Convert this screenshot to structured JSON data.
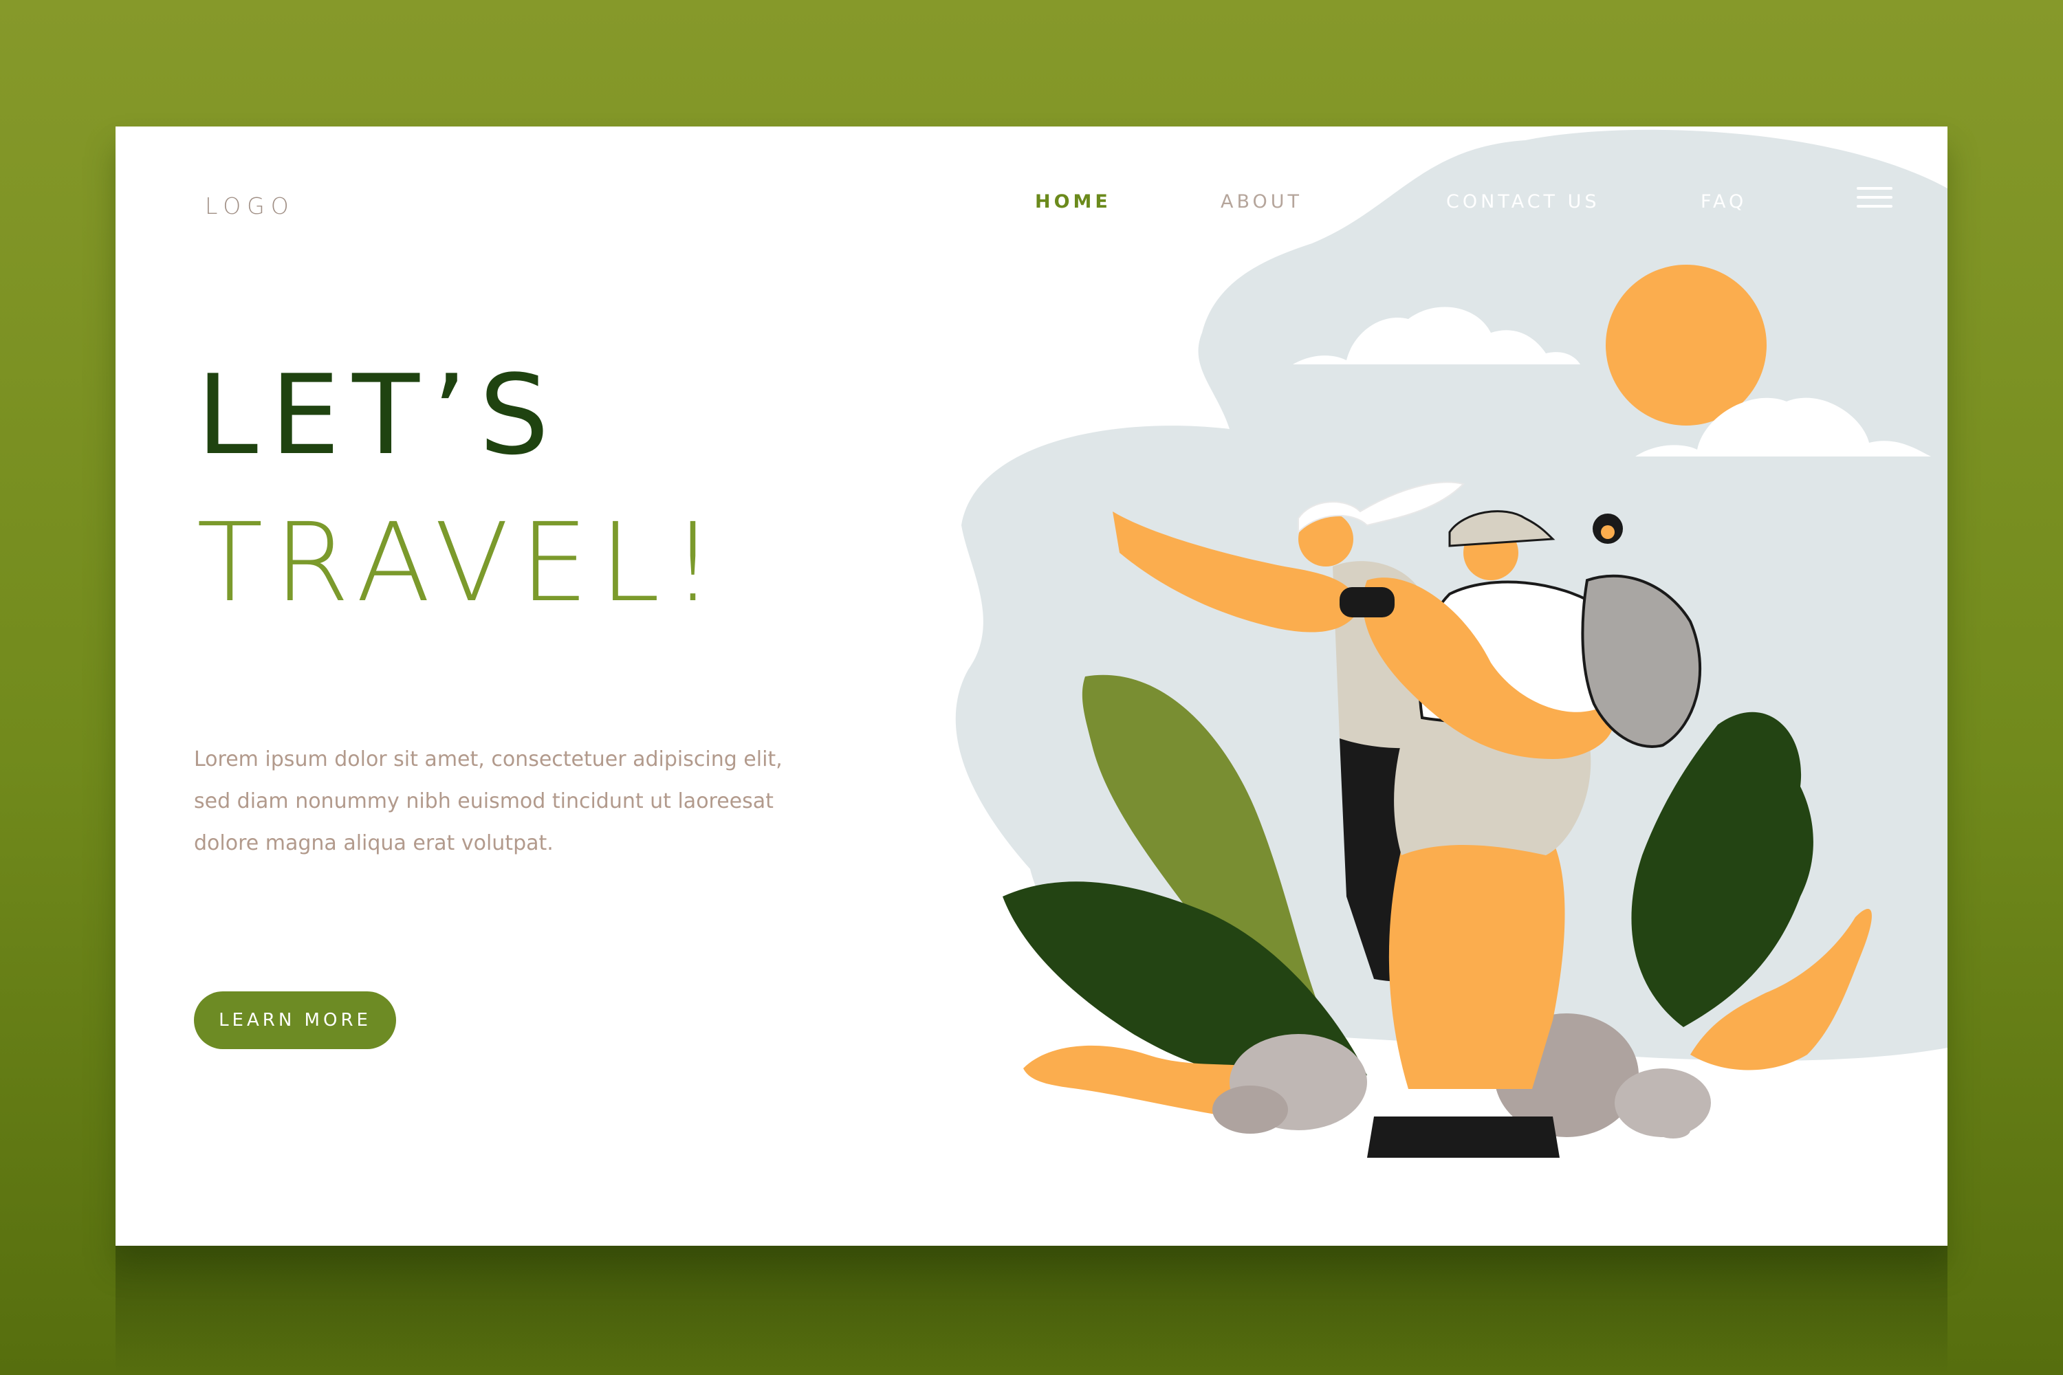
{
  "header": {
    "logo": "LOGO",
    "nav": [
      {
        "label": "HOME",
        "active": true
      },
      {
        "label": "ABOUT",
        "active": false
      },
      {
        "label": "CONTACT US",
        "active": false
      },
      {
        "label": "FAQ",
        "active": false
      }
    ],
    "menu_icon": "hamburger-menu-icon"
  },
  "hero": {
    "headline_line1": "LET’S",
    "headline_line2": "TRAVEL!",
    "body_line1": "Lorem ipsum dolor sit amet, consectetuer adipiscing elit,",
    "body_line2": "sed diam nonummy nibh euismod tincidunt ut laoreesat",
    "body_line3": "dolore magna aliqua erat volutpat.",
    "cta_label": "LEARN MORE"
  },
  "colors": {
    "background": "#7a921f",
    "accent": "#6d8b24",
    "headline_dark": "#1f4310",
    "headline_light": "#7b9a2c",
    "sky": "#dde6e8",
    "sun": "#fbad4e"
  }
}
